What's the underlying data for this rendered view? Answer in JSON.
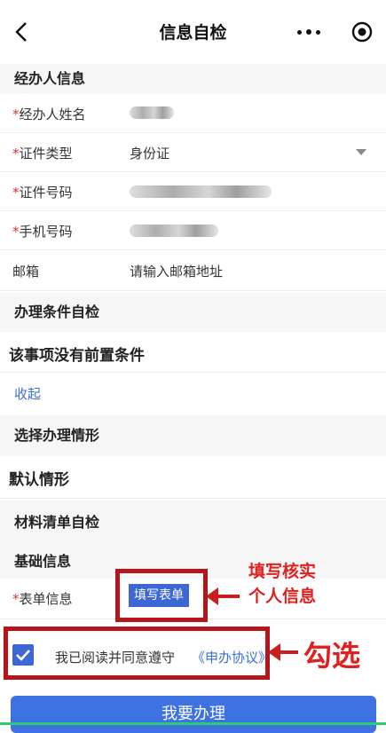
{
  "nav": {
    "title": "信息自检",
    "icons": [
      "back-icon",
      "more-icon",
      "target-icon"
    ]
  },
  "agent_section": {
    "title": "经办人信息",
    "fields": [
      {
        "label": "经办人姓名",
        "required": true,
        "value": "",
        "blurred": true
      },
      {
        "label": "证件类型",
        "required": true,
        "value": "身份证",
        "dropdown": true
      },
      {
        "label": "证件号码",
        "required": true,
        "value": "",
        "blurred": true
      },
      {
        "label": "手机号码",
        "required": true,
        "value": "",
        "blurred": true
      },
      {
        "label": "邮箱",
        "required": false,
        "value": "",
        "placeholder": "请输入邮箱地址"
      }
    ]
  },
  "conditions_section": {
    "title": "办理条件自检",
    "text": "该事项没有前置条件",
    "collapse_label": "收起"
  },
  "situation_section": {
    "title": "选择办理情形",
    "text": "默认情形"
  },
  "materials_section": {
    "title": "材料清单自检"
  },
  "basic_section": {
    "title": "基础信息",
    "form_label": "表单信息",
    "form_required": true,
    "fill_button": "填写表单"
  },
  "annotations": {
    "fill_note_line1": "填写核实",
    "fill_note_line2": "个人信息",
    "check_note": "勾选"
  },
  "agreement": {
    "text": "我已阅读并同意遵守",
    "link": "《申办协议》",
    "checked": true
  },
  "submit_label": "我要办理",
  "colors": {
    "primary": "#3d67d3",
    "required": "#e03131",
    "annotation_red": "#b3151b",
    "section_bg": "#f6f6f6"
  }
}
